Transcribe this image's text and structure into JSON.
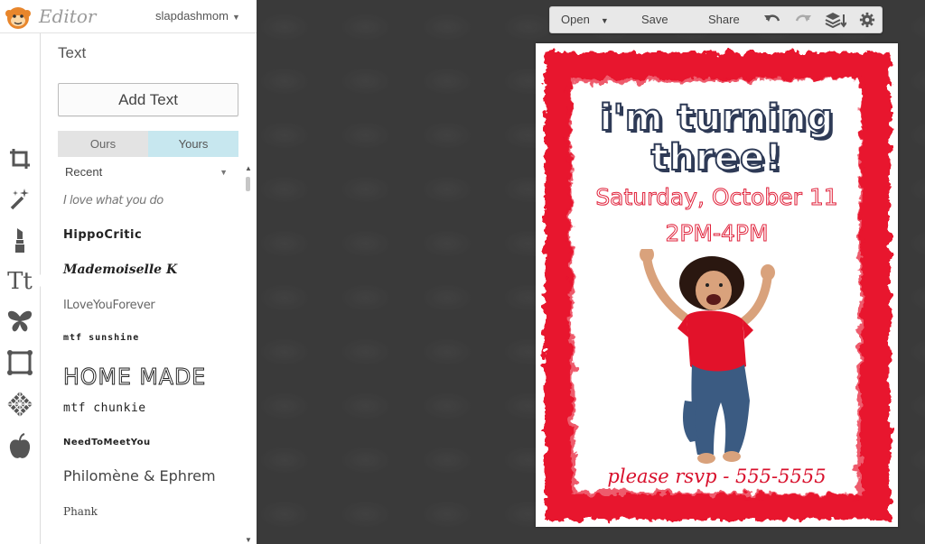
{
  "app": {
    "name": "Editor",
    "user": "slapdashmom"
  },
  "rail": {
    "icons": [
      "crop-icon",
      "magic-wand-icon",
      "lipstick-icon",
      "text-icon",
      "butterfly-icon",
      "frame-icon",
      "texture-icon",
      "apple-icon"
    ],
    "text_icon_label": "Tt"
  },
  "panel": {
    "title": "Text",
    "add_text_label": "Add Text",
    "tabs": [
      {
        "label": "Ours",
        "active": false
      },
      {
        "label": "Yours",
        "active": true
      }
    ],
    "category": "Recent",
    "fonts": [
      "I love what you do",
      "HippoCritic",
      "Mademoiselle K",
      "ILoveYouForever",
      "mtf sunshine",
      "HOME MADE",
      "mtf chunkie",
      "NeedToMeetYou",
      "Philomène & Ephrem",
      "Phank"
    ]
  },
  "toolbar": {
    "open_label": "Open",
    "save_label": "Save",
    "share_label": "Share"
  },
  "flyer": {
    "title_line1": "i'm turning",
    "title_line2": "three!",
    "date": "Saturday, October 11",
    "time": "2PM-4PM",
    "rsvp": "please rsvp - 555-5555",
    "colors": {
      "border": "#e8142e",
      "title_outline": "#2e3a56",
      "accent_text": "#e0223b"
    }
  }
}
